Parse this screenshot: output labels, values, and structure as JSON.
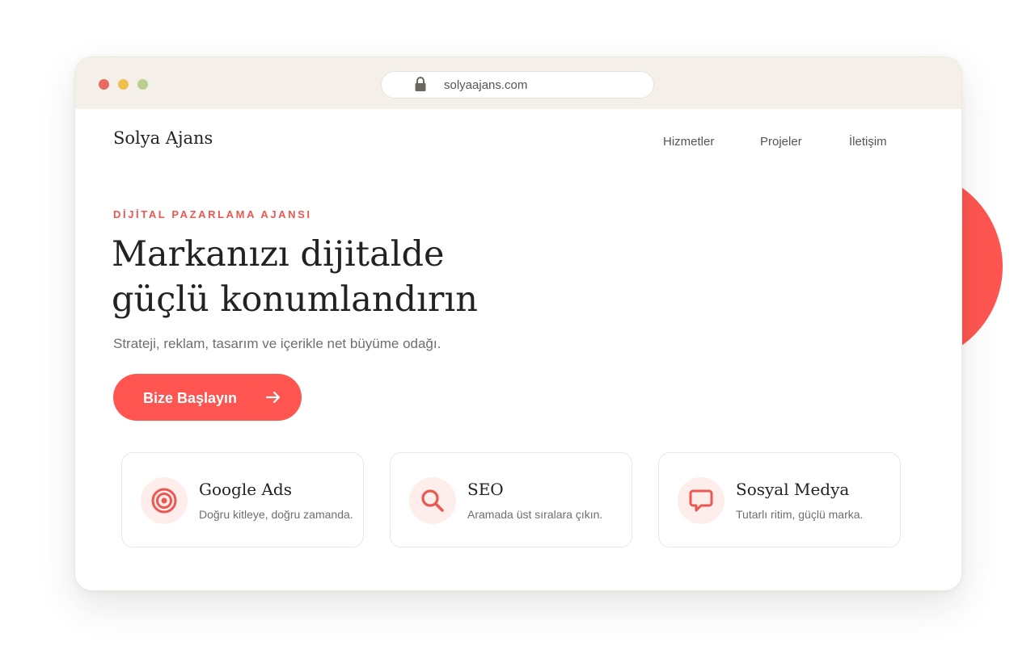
{
  "browser": {
    "url": "solyaajans.com",
    "traffic_lights": [
      "#e96a60",
      "#f0c04e",
      "#b9d08e"
    ]
  },
  "site": {
    "brand": "Solya Ajans",
    "nav": [
      "Hizmetler",
      "Projeler",
      "İletişim"
    ]
  },
  "hero": {
    "eyebrow": "DİJİTAL PAZARLAMA AJANSI",
    "headline_line1": "Markanızı dijitalde",
    "headline_line2": "güçlü konumlandırın",
    "subtext": "Strateji, reklam, tasarım ve içerikle net büyüme odağı.",
    "cta_label": "Bize Başlayın",
    "cta_icon": "arrow-right-icon"
  },
  "services": [
    {
      "icon": "target-icon",
      "title": "Google Ads",
      "description": "Doğru kitleye, doğru zamanda."
    },
    {
      "icon": "search-icon",
      "title": "SEO",
      "description": "Aramada üst sıralara çıkın."
    },
    {
      "icon": "chat-bubble-icon",
      "title": "Sosyal Medya",
      "description": "Tutarlı ritim, güçlü marka."
    }
  ],
  "colors": {
    "accent": "#ff5550",
    "chrome": "#f4f0e9",
    "icon_bg": "#fdeeec"
  }
}
